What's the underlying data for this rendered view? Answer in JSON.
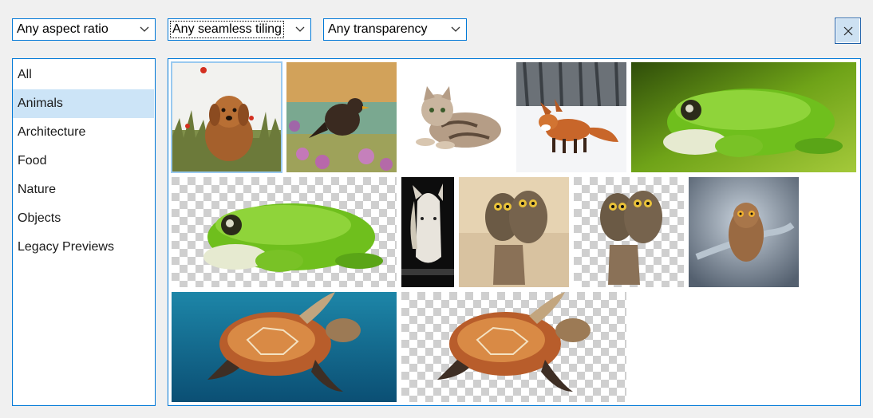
{
  "filters": {
    "aspect_ratio": {
      "selected": "Any aspect ratio"
    },
    "seamless_tiling": {
      "selected": "Any seamless tiling"
    },
    "transparency": {
      "selected": "Any transparency"
    }
  },
  "close_button": {
    "icon": "close-icon"
  },
  "categories": {
    "selected_index": 1,
    "items": [
      "All",
      "Animals",
      "Architecture",
      "Food",
      "Nature",
      "Objects",
      "Legacy Previews"
    ]
  },
  "gallery": {
    "selected_index": 0,
    "images": [
      {
        "name": "dog-in-meadow",
        "transparent": false
      },
      {
        "name": "blackbird-in-flowers",
        "transparent": false
      },
      {
        "name": "lying-kitten",
        "transparent": false
      },
      {
        "name": "fox-in-snow",
        "transparent": false
      },
      {
        "name": "green-frog",
        "transparent": false
      },
      {
        "name": "green-frog-cutout",
        "transparent": true
      },
      {
        "name": "white-horse",
        "transparent": false
      },
      {
        "name": "two-owls-on-stump",
        "transparent": false
      },
      {
        "name": "two-owls-cutout",
        "transparent": true
      },
      {
        "name": "owl-on-branch",
        "transparent": false
      },
      {
        "name": "sea-turtle",
        "transparent": false
      },
      {
        "name": "sea-turtle-cutout",
        "transparent": true
      }
    ]
  },
  "colors": {
    "accent_border": "#0078d7",
    "selection": "#cce4f7",
    "window_bg": "#f0f0f0"
  }
}
